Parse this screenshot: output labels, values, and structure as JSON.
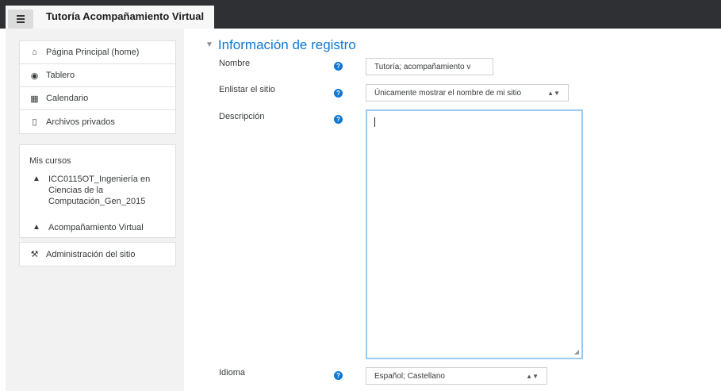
{
  "header": {
    "title": "Tutoría Acompañamiento Virtual",
    "menu_icon": "hamburger-icon"
  },
  "sidebar": {
    "nav": [
      {
        "label": "Página Principal (home)",
        "icon": "home-icon"
      },
      {
        "label": "Tablero",
        "icon": "dashboard-icon"
      },
      {
        "label": "Calendario",
        "icon": "calendar-icon"
      },
      {
        "label": "Archivos privados",
        "icon": "file-icon"
      }
    ],
    "courses_heading": "Mis cursos",
    "courses": [
      {
        "label_line1": "ICC0115OT_Ingeniería en",
        "label_line2": "Ciencias de la",
        "label_line3": "Computación_Gen_2015",
        "icon": "graduation-cap-icon"
      },
      {
        "label_line1": "Acompañamiento Virtual",
        "icon": "graduation-cap-icon"
      }
    ],
    "admin": {
      "label": "Administración del sitio",
      "icon": "wrench-icon"
    }
  },
  "form": {
    "section_title": "Información de registro",
    "fields": {
      "nombre": {
        "label": "Nombre",
        "value": "Tutoría; acompañamiento v"
      },
      "enlistar": {
        "label": "Enlistar el sitio",
        "value": "Únicamente mostrar el nombre de mi sitio"
      },
      "descripcion": {
        "label": "Descripción",
        "value": ""
      },
      "idioma": {
        "label": "Idioma",
        "value": "Español; Castellano"
      }
    },
    "help_glyph": "?"
  }
}
